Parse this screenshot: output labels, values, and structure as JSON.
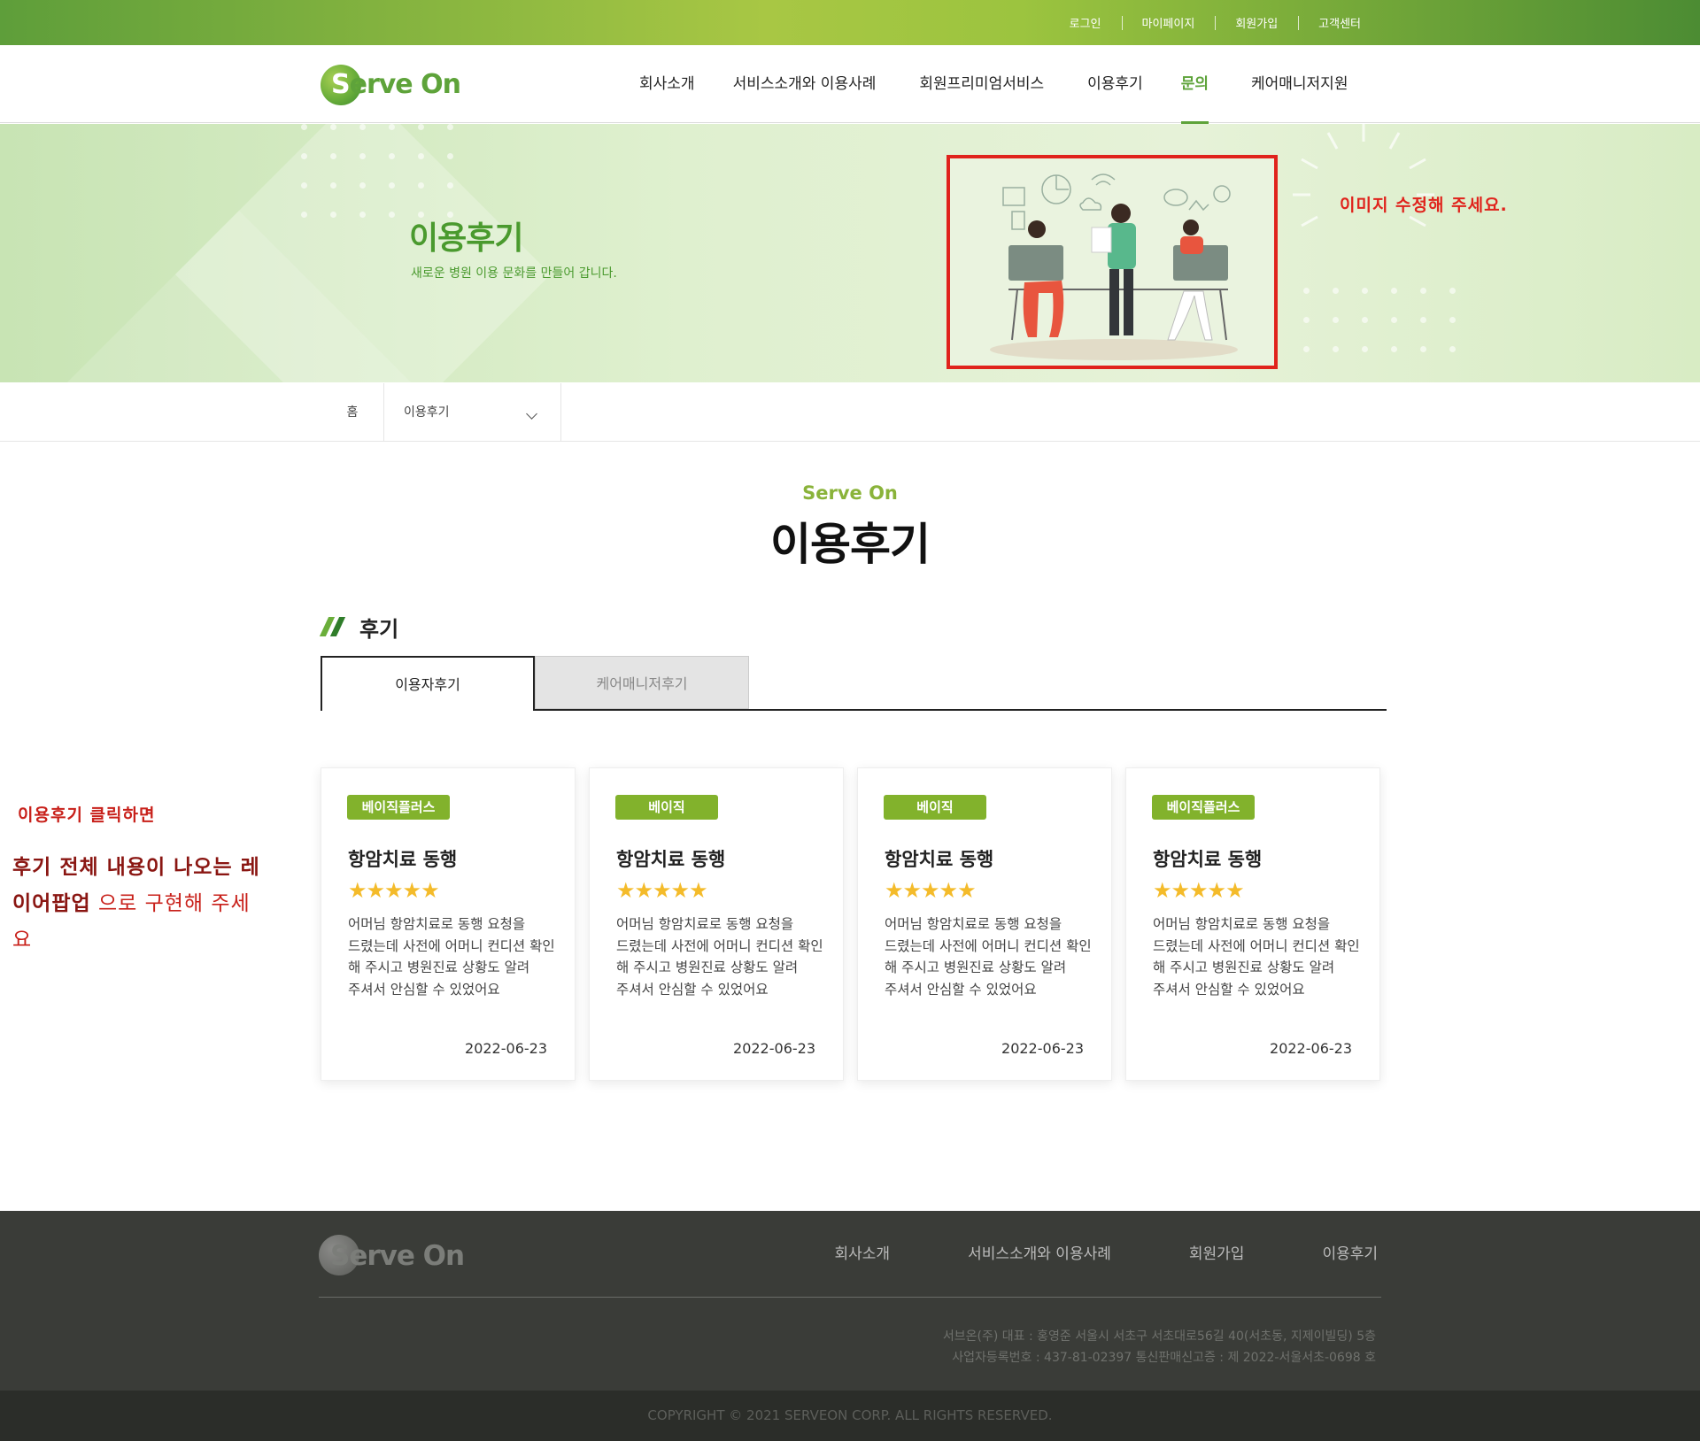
{
  "utility_nav": [
    "로그인",
    "마이페이지",
    "회원가입",
    "고객센터"
  ],
  "logo": {
    "s": "S",
    "rest": "erve On"
  },
  "gnb": [
    "회사소개",
    "서비스소개와 이용사례",
    "회원프리미엄서비스",
    "이용후기",
    "문의",
    "케어매니저지원"
  ],
  "gnb_active": "문의",
  "hero": {
    "title": "이용후기",
    "subtitle": "새로운 병원 이용 문화를 만들어 갑니다.",
    "edit_note": "이미지 수정해 주세요."
  },
  "breadcrumb": {
    "home": "홈",
    "current": "이용후기"
  },
  "section": {
    "kicker": "Serve On",
    "title": "이용후기",
    "subtitle": "후기"
  },
  "tabs": {
    "active": "이용자후기",
    "inactive": "케어매니저후기"
  },
  "cards": [
    {
      "badge": "베이직플러스",
      "title": "항암치료 동행",
      "stars": "★★★★★",
      "body": "어머님 항암치료로 동행 요청을 드렸는데 사전에 어머니 컨디션 확인 해 주시고 병원진료 상황도 알려 주셔서 안심할 수 있었어요",
      "date": "2022-06-23"
    },
    {
      "badge": "베이직",
      "title": "항암치료 동행",
      "stars": "★★★★★",
      "body": "어머님 항암치료로 동행 요청을 드렸는데 사전에 어머니 컨디션 확인 해 주시고 병원진료 상황도 알려 주셔서 안심할 수 있었어요",
      "date": "2022-06-23"
    },
    {
      "badge": "베이직",
      "title": "항암치료 동행",
      "stars": "★★★★★",
      "body": "어머님 항암치료로 동행 요청을 드렸는데 사전에 어머니 컨디션 확인 해 주시고 병원진료 상황도 알려 주셔서 안심할 수 있었어요",
      "date": "2022-06-23"
    },
    {
      "badge": "베이직플러스",
      "title": "항암치료 동행",
      "stars": "★★★★★",
      "body": "어머님 항암치료로 동행 요청을 드렸는데 사전에 어머니 컨디션 확인 해 주시고 병원진료 상황도 알려 주셔서 안심할 수 있었어요",
      "date": "2022-06-23"
    }
  ],
  "side_note": {
    "line1": "이용후기 클릭하면",
    "line2_bold": "후기 전체 내용이 나오는 레이어팝업",
    "line2_rest": " 으로 구현해 주세요"
  },
  "footer": {
    "logo_text": "Serve On",
    "nav": [
      "회사소개",
      "서비스소개와 이용사례",
      "회원가입",
      "이용후기"
    ],
    "info_line1": "서브온(주) 대표 : 홍영준 서울시 서초구 서초대로56길 40(서초동, 지제이빌딩) 5층",
    "info_line2": "사업자등록번호 : 437-81-02397  통신판매신고증 : 제 2022-서울서초-0698 호",
    "copyright": "COPYRIGHT © 2021 SERVEON CORP. ALL RIGHTS RESERVED."
  },
  "colors": {
    "brand_green": "#5ea33a",
    "badge_green": "#82b22c",
    "star": "#f4bb2a",
    "annotation_red": "#e0231c"
  }
}
